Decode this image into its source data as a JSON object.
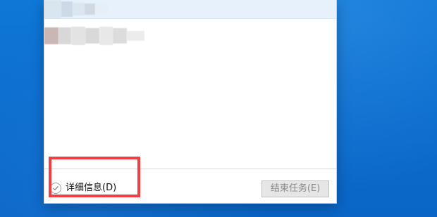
{
  "bottom_bar": {
    "details_label": "详细信息(D)",
    "end_task_label": "结束任务(E)"
  },
  "icons": {
    "details_toggle": "check-circle-icon"
  },
  "colors": {
    "desktop": "#0c6fd0",
    "selection_row": "#e6f1fb",
    "annotation": "#ef3f43",
    "disabled_button": "#e6e6e6"
  }
}
